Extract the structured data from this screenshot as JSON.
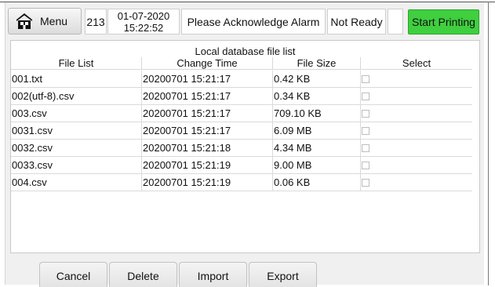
{
  "header": {
    "menu_label": "Menu",
    "count": "213",
    "date": "01-07-2020",
    "time": "15:22:52",
    "alarm_text": "Please Acknowledge Alarm",
    "status": "Not Ready",
    "start_label": "Start Printing",
    "start_color": "#3fcf3f",
    "menu_icon": "home-icon"
  },
  "table": {
    "title": "Local database file list",
    "columns": [
      "File List",
      "Change Time",
      "File Size",
      "Select"
    ],
    "rows": [
      {
        "file": "001.txt",
        "time": "20200701 15:21:17",
        "size": "0.42 KB"
      },
      {
        "file": "002(utf-8).csv",
        "time": "20200701 15:21:17",
        "size": "0.34 KB"
      },
      {
        "file": "003.csv",
        "time": "20200701 15:21:17",
        "size": "709.10 KB"
      },
      {
        "file": "0031.csv",
        "time": "20200701 15:21:17",
        "size": "6.09 MB"
      },
      {
        "file": "0032.csv",
        "time": "20200701 15:21:18",
        "size": "4.34 MB"
      },
      {
        "file": "0033.csv",
        "time": "20200701 15:21:19",
        "size": "9.00 MB"
      },
      {
        "file": "004.csv",
        "time": "20200701 15:21:19",
        "size": "0.06 KB"
      }
    ]
  },
  "footer": {
    "cancel_label": "Cancel",
    "delete_label": "Delete",
    "import_label": "Import",
    "export_label": "Export"
  }
}
